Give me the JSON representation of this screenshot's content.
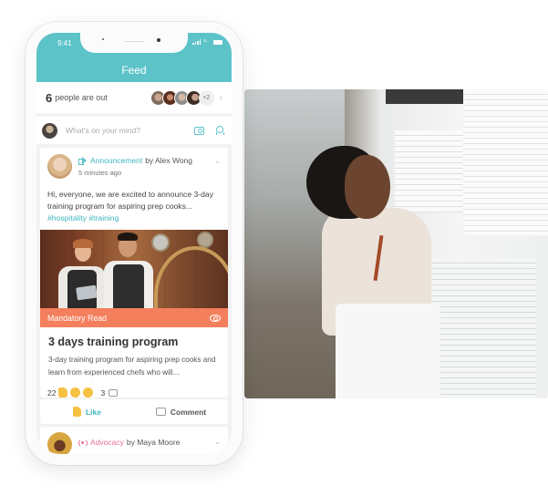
{
  "status_bar": {
    "time": "9:41"
  },
  "header": {
    "title": "Feed"
  },
  "people_out": {
    "count": "6",
    "label": "people are out",
    "more_badge": "+2",
    "avatar_colors": [
      "#9c8a7a",
      "#6d3f2a",
      "#a3a3a3",
      "#4b3b33"
    ]
  },
  "compose": {
    "placeholder": "What's on your mind?",
    "camera_icon": "camera-icon",
    "award_icon": "award-icon"
  },
  "post": {
    "type": "Announcement",
    "by_label": "by Alex Wong",
    "time_ago": "5 minutes ago",
    "body": "Hi, everyone, we are excited to announce 3-day training program for aspiring prep cooks...",
    "tags": "#hospitality #training",
    "banner_label": "Mandatory Read",
    "title": "3 days training program",
    "description": "3-day training program for aspiring prep cooks and learn from experienced chefs who will...",
    "reaction_count": "22",
    "comment_count": "3"
  },
  "actions": {
    "like_label": "Like",
    "comment_label": "Comment"
  },
  "next_post": {
    "type": "Advocacy",
    "by_label": "by Maya Moore"
  },
  "colors": {
    "brand": "#5cc3c9",
    "accent_teal": "#3fb6bd",
    "mandatory": "#f47f5d",
    "advocacy": "#e56fa0",
    "reaction": "#f6c042"
  }
}
